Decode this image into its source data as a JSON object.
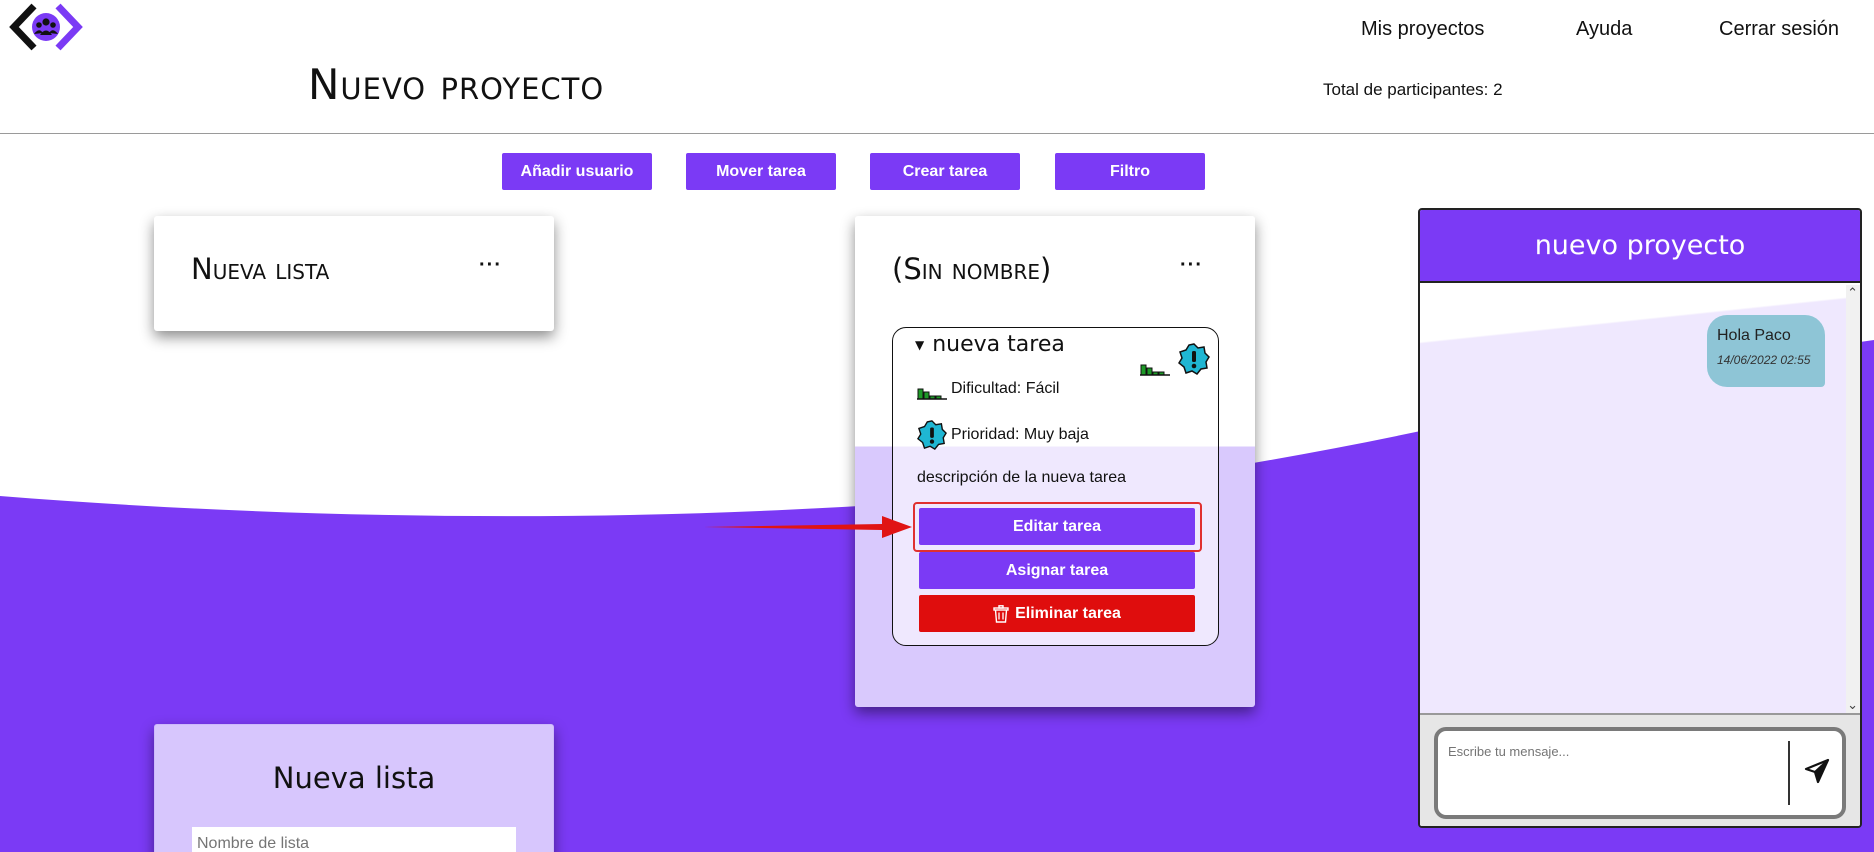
{
  "app": {
    "colors": {
      "accent": "#7b3af5",
      "danger": "#df0d0d",
      "chat_bubble": "#8ec5d6",
      "light_lavender": "#d9c9fd"
    }
  },
  "nav": {
    "links": [
      "Mis proyectos",
      "Ayuda",
      "Cerrar sesión"
    ]
  },
  "header": {
    "title": "Nuevo proyecto",
    "participants": "Total de participantes: 2"
  },
  "toolbar": {
    "buttons": [
      "Añadir usuario",
      "Mover tarea",
      "Crear tarea",
      "Filtro"
    ]
  },
  "lists": [
    {
      "title": "Nueva lista",
      "menu": "···"
    },
    {
      "title": "(Sin nombre)",
      "menu": "···",
      "task": {
        "name": "nueva tarea",
        "difficulty": "Dificultad: Fácil",
        "priority": "Prioridad: Muy baja",
        "description": "descripción de la nueva tarea",
        "buttons": {
          "edit": "Editar tarea",
          "assign": "Asignar tarea",
          "delete": "Eliminar tarea"
        }
      }
    }
  ],
  "new_list_form": {
    "title": "Nueva lista",
    "placeholder": "Nombre de lista"
  },
  "chat": {
    "title": "nuevo proyecto",
    "messages": [
      {
        "text": "Hola Paco",
        "time": "14/06/2022 02:55"
      }
    ],
    "input_placeholder": "Escribe tu mensaje..."
  },
  "icons": {
    "logo": "team-logo-icon",
    "difficulty": "difficulty-bars-icon",
    "priority": "priority-alert-icon",
    "delete": "trash-icon",
    "send": "send-icon",
    "expand": "triangle-down-icon"
  }
}
